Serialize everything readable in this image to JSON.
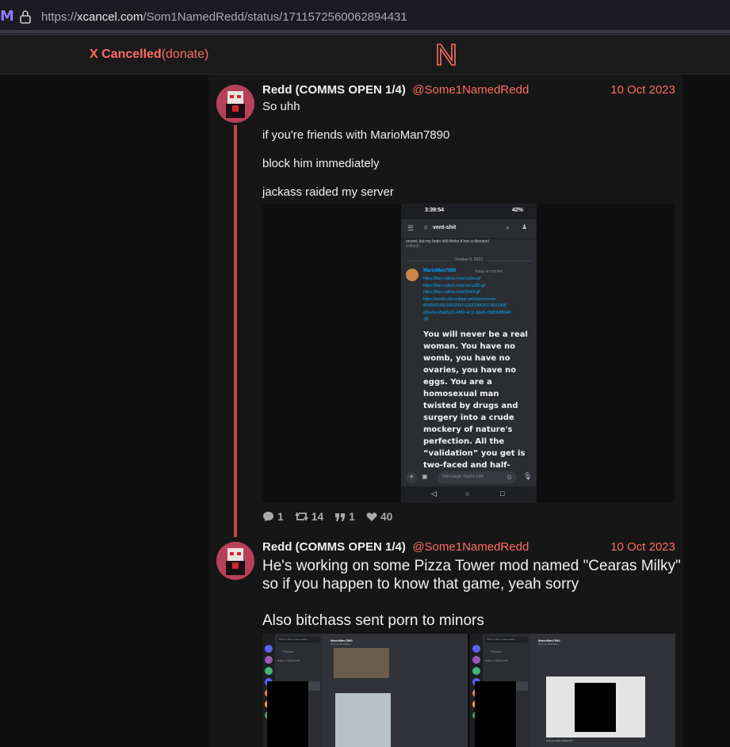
{
  "browser": {
    "url_prefix": "https://",
    "url_host": "xcancel.com",
    "url_path": "/Som1NamedRedd/status/1711572560062894431",
    "ext_icon": "M",
    "lock_icon": "lock-icon"
  },
  "nav": {
    "brand_bold": "X Cancelled",
    "brand_link": "(donate)",
    "logo": "N"
  },
  "tweets": [
    {
      "fullname": "Redd (COMMS OPEN 1/4)",
      "username": "@Some1NamedRedd",
      "date": "10 Oct 2023",
      "lines": [
        "So uhh",
        "if you're friends with MarioMan7890",
        "block him immediately",
        "jackass raided my server"
      ],
      "stats": {
        "replies": "1",
        "retweets": "14",
        "quotes": "1",
        "likes": "40"
      }
    },
    {
      "fullname": "Redd (COMMS OPEN 1/4)",
      "username": "@Some1NamedRedd",
      "date": "10 Oct 2023",
      "lines": [
        "He's working on some Pizza Tower mod named \"Cearas Milky\"",
        "so if you happen to know that game, yeah sorry",
        "Also bitchass sent porn to minors"
      ]
    }
  ],
  "screenshot1": {
    "time": "3:39:54",
    "battery": "42%",
    "channel": "vent-shit",
    "prev_msg": "recent, but my brain still thinks it has a disease)",
    "prev_edited": "(edited)",
    "divider": "October 9, 2023",
    "author": "MarioMan7890",
    "timestamp": "Today at 3:32 PM",
    "links": [
      "https://files.catbox.moe/cecbh.gif",
      "https://files.catbox.moe/veeu380.gif",
      "https://files.catbox.moe/5tb64.gif",
      "https://media.discordapp.net/attachments",
      "/838009169119532937/1152035520178152008",
      "/dfye0n-65a86c23-4950-4c11-bda8-c9983b8834f0",
      ".gif"
    ],
    "message": "You will never be a real woman. You have no womb, you have no ovaries, you have no eggs. You are a homosexual man twisted by drugs and surgery into a crude mockery of nature's perfection. All the “validation” you get is two-faced and half-hearted. Behind your back people mock you. Your parents are",
    "input_placeholder": "Message #vent-shit"
  },
  "screenshot2": {
    "search_placeholder": "Find or start a conversation",
    "friends": "Friends",
    "dm_header": "DIRECT MESSAGES",
    "user": "MarioMan7890",
    "user_status": "Pizzing Milkshakes",
    "right_caption": "sure you dont wanna try?"
  },
  "colors": {
    "accent": "#ff6c60",
    "thread": "#c44a43",
    "link": "#00a8fc"
  }
}
